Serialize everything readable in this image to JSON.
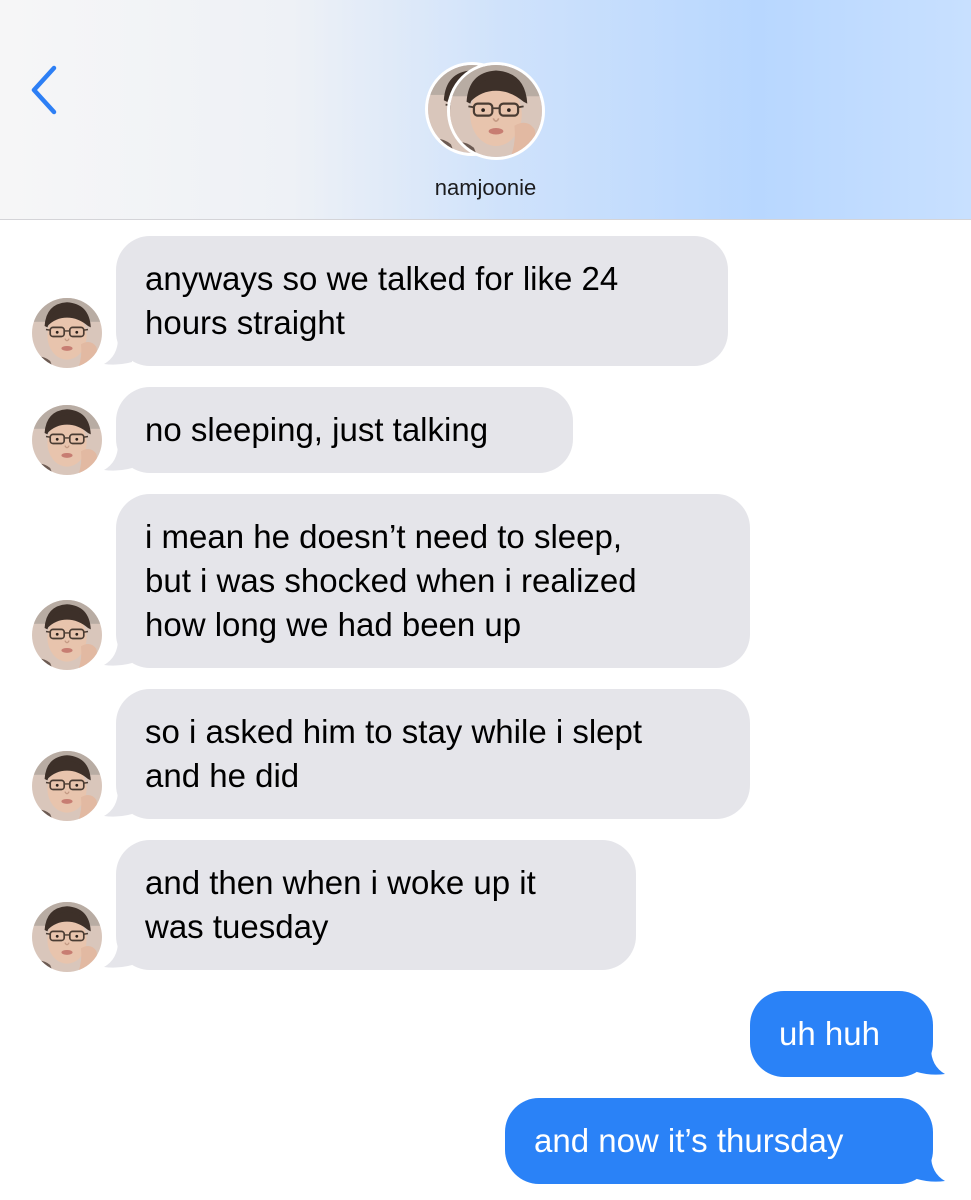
{
  "header": {
    "contact_name": "namjoonie"
  },
  "messages": [
    {
      "direction": "incoming",
      "line1": "anyways so we talked for like 24",
      "line2": "hours straight"
    },
    {
      "direction": "incoming",
      "line1": "no sleeping, just talking"
    },
    {
      "direction": "incoming",
      "line1": "i mean he doesn’t need to sleep,",
      "line2": "but i was shocked when i realized",
      "line3": "how long we had been up"
    },
    {
      "direction": "incoming",
      "line1": "so i asked him to stay while i slept",
      "line2": "and he did"
    },
    {
      "direction": "incoming",
      "line1": "and then when i woke up it",
      "line2": "was tuesday"
    },
    {
      "direction": "outgoing",
      "line1": "uh huh"
    },
    {
      "direction": "outgoing",
      "line1": "and now it’s thursday"
    }
  ],
  "colors": {
    "incoming_bubble": "#e5e5ea",
    "outgoing_bubble": "#2a82f7",
    "accent": "#2d7ff5"
  },
  "icons": {
    "back": "chevron-left-icon",
    "avatar": "contact-avatar"
  }
}
